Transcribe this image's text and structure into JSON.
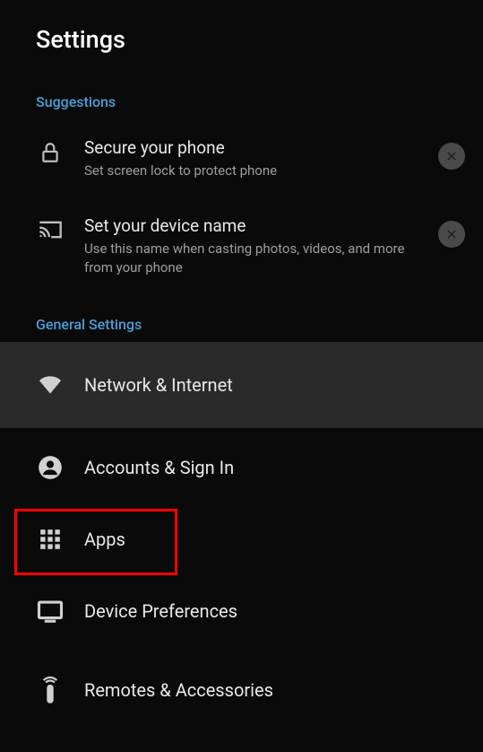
{
  "page": {
    "title": "Settings"
  },
  "sections": {
    "suggestions_header": "Suggestions",
    "general_header": "General Settings"
  },
  "suggestions": {
    "secure": {
      "title": "Secure your phone",
      "desc": "Set screen lock to protect phone"
    },
    "device_name": {
      "title": "Set your device name",
      "desc": "Use this name when casting photos, videos, and more from your phone"
    }
  },
  "general": {
    "network": "Network & Internet",
    "accounts": "Accounts & Sign In",
    "apps": "Apps",
    "device_prefs": "Device Preferences",
    "remotes": "Remotes & Accessories"
  }
}
